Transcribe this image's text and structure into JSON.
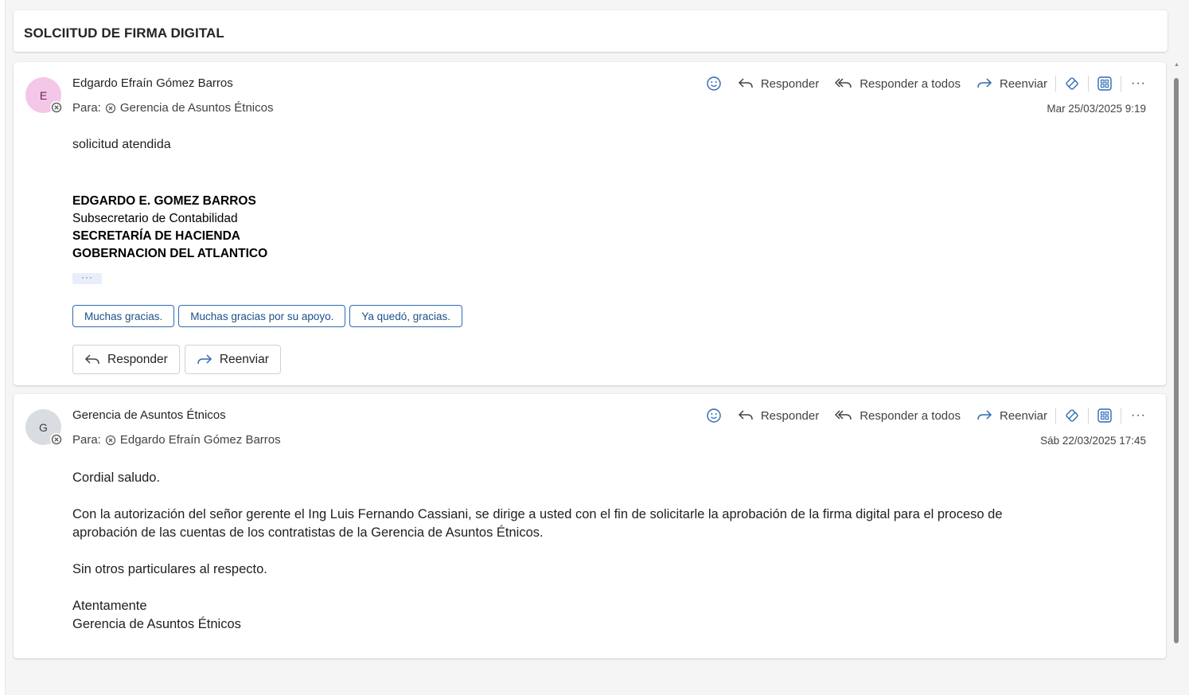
{
  "subject": "SOLCIITUD DE FIRMA DIGITAL",
  "actions": {
    "reply": "Responder",
    "reply_all": "Responder a todos",
    "forward": "Reenviar",
    "more": "···"
  },
  "to_label": "Para:",
  "messages": [
    {
      "avatar_initial": "E",
      "sender": "Edgardo Efraín Gómez Barros",
      "to": "Gerencia de Asuntos Étnicos",
      "date": "Mar 25/03/2025 9:19",
      "body": "solicitud atendida",
      "signature": {
        "name": "EDGARDO E. GOMEZ BARROS",
        "role": "Subsecretario de Contabilidad",
        "dept": "SECRETARÍA DE HACIENDA",
        "org": "GOBERNACION DEL ATLANTICO"
      },
      "expand_dots": "···",
      "suggestions": [
        "Muchas gracias.",
        "Muchas gracias por su apoyo.",
        "Ya quedó, gracias."
      ],
      "reply_button": "Responder",
      "forward_button": "Reenviar"
    },
    {
      "avatar_initial": "G",
      "sender": "Gerencia de Asuntos Étnicos",
      "to": "Edgardo Efraín Gómez Barros",
      "date": "Sáb 22/03/2025 17:45",
      "paragraphs": [
        "Cordial saludo.",
        "Con la autorización del señor gerente el Ing Luis Fernando Cassiani, se dirige a usted con el fin de solicitarle la aprobación de la firma digital para el proceso de",
        "aprobación de las cuentas de los contratistas de la Gerencia de Asuntos Étnicos.",
        "Sin otros particulares al respecto.",
        "Atentamente",
        "Gerencia de Asuntos Étnicos"
      ]
    }
  ],
  "colors": {
    "accent": "#2d6ab3",
    "avatar_e": "#f4c6e8",
    "avatar_g": "#d9dde2"
  }
}
